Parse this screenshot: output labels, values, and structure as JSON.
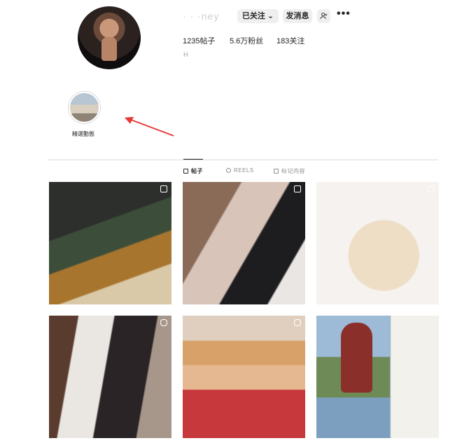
{
  "profile": {
    "username": "·  ·  ·ney",
    "follow_label": "已关注 ⌄",
    "message_label": "发消息",
    "add_user_icon": "add-user-icon",
    "more_icon": "more-icon",
    "stats": {
      "posts": "1235帖子",
      "followers": "5.6万粉丝",
      "following": "183关注"
    },
    "bio": "H"
  },
  "highlight": {
    "label": "精選動態"
  },
  "tabs": [
    {
      "label": "帖子",
      "icon": "grid-icon",
      "active": true
    },
    {
      "label": "REELS",
      "icon": "reels-icon",
      "active": false
    },
    {
      "label": "标记内容",
      "icon": "tag-icon",
      "active": false
    }
  ],
  "posts": [
    {
      "icon": "multi-photo-icon"
    },
    {
      "icon": "multi-photo-icon"
    },
    {
      "icon": "reel-icon"
    },
    {
      "icon": "reel-icon"
    },
    {
      "icon": "reel-icon"
    },
    {
      "icon": ""
    }
  ],
  "colors": {
    "annotation_arrow": "#e53935",
    "button_bg": "#efefef"
  }
}
